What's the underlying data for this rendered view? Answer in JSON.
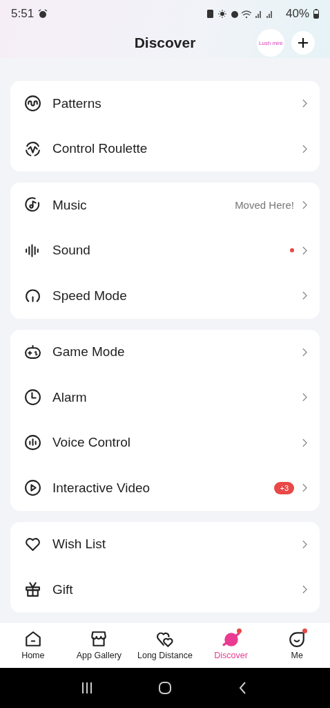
{
  "status_bar": {
    "time": "5:51",
    "battery": "40%"
  },
  "header": {
    "title": "Discover",
    "device_label": "Lush mini"
  },
  "groups": [
    {
      "items": [
        {
          "label": "Patterns"
        },
        {
          "label": "Control Roulette"
        }
      ]
    },
    {
      "items": [
        {
          "label": "Music",
          "note": "Moved Here!"
        },
        {
          "label": "Sound",
          "dot": true
        },
        {
          "label": "Speed Mode"
        }
      ]
    },
    {
      "items": [
        {
          "label": "Game Mode"
        },
        {
          "label": "Alarm"
        },
        {
          "label": "Voice Control"
        },
        {
          "label": "Interactive Video",
          "badge": "+3"
        }
      ]
    },
    {
      "items": [
        {
          "label": "Wish List"
        },
        {
          "label": "Gift"
        }
      ]
    }
  ],
  "tabs": [
    {
      "label": "Home",
      "selected": false,
      "dot": false
    },
    {
      "label": "App Gallery",
      "selected": false,
      "dot": false
    },
    {
      "label": "Long Distance",
      "selected": false,
      "dot": false
    },
    {
      "label": "Discover",
      "selected": true,
      "dot": true
    },
    {
      "label": "Me",
      "selected": false,
      "dot": true
    }
  ]
}
